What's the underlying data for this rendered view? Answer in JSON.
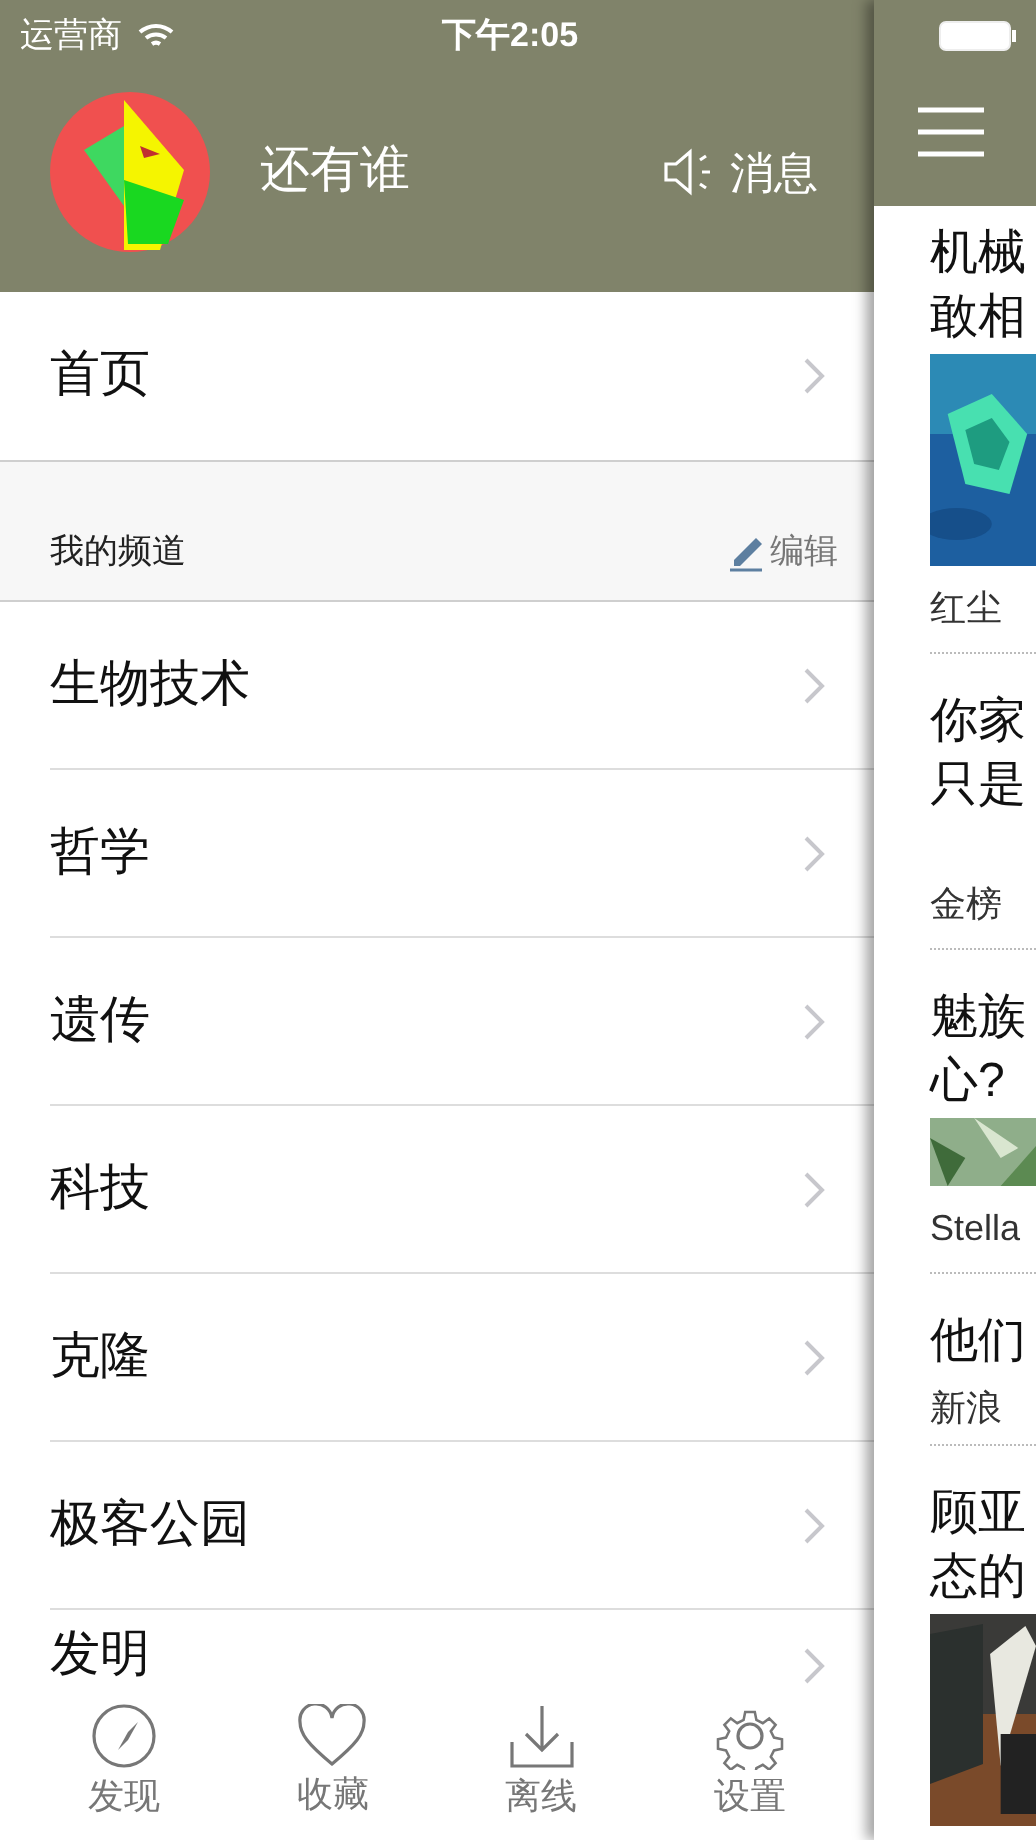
{
  "status_bar": {
    "carrier": "运营商",
    "time": "下午2:05"
  },
  "profile": {
    "name": "还有谁",
    "messages": "消息"
  },
  "home": {
    "label": "首页"
  },
  "section": {
    "title": "我的频道",
    "edit": "编辑"
  },
  "channels": [
    {
      "label": "生物技术"
    },
    {
      "label": "哲学"
    },
    {
      "label": "遗传"
    },
    {
      "label": "科技"
    },
    {
      "label": "克隆"
    },
    {
      "label": "极客公园"
    },
    {
      "label": "发明"
    }
  ],
  "tab_bar": [
    {
      "label": "发现",
      "kind": "compass"
    },
    {
      "label": "收藏",
      "kind": "heart"
    },
    {
      "label": "离线",
      "kind": "download"
    },
    {
      "label": "设置",
      "kind": "gear"
    }
  ],
  "feed": [
    {
      "kind": "picture",
      "title": [
        "机械",
        "敢相"
      ],
      "source": "红尘"
    },
    {
      "kind": "text",
      "title": [
        "你家",
        "只是"
      ],
      "source": "金榜"
    },
    {
      "kind": "picture",
      "title": [
        "魅族",
        "心?"
      ],
      "source": "Stella"
    },
    {
      "kind": "text",
      "title": [
        "他们"
      ],
      "source": "新浪"
    },
    {
      "kind": "picture",
      "title": [
        "顾亚",
        "态的"
      ]
    }
  ]
}
